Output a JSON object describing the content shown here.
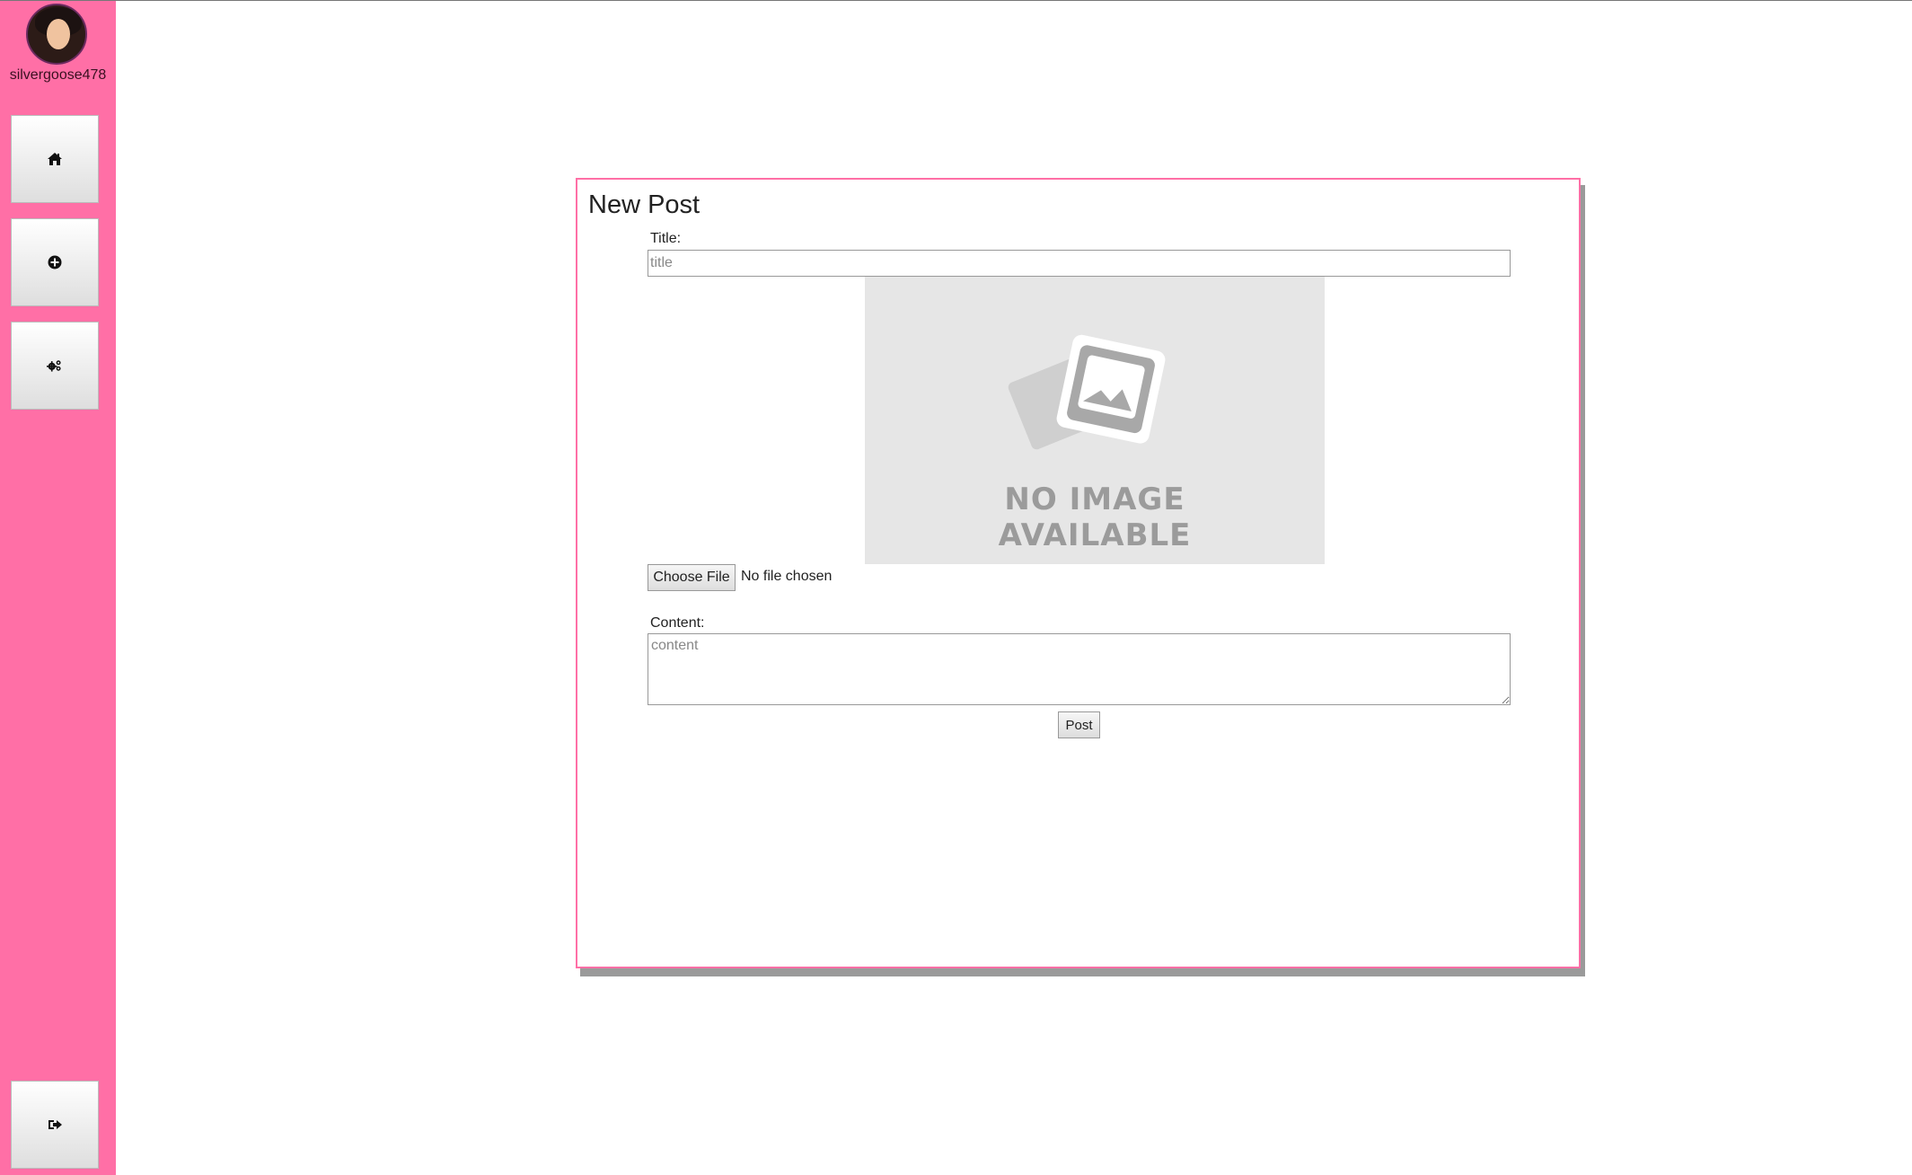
{
  "sidebar": {
    "username": "silvergoose478",
    "accent_color": "#ff6fa6",
    "nav": [
      {
        "icon": "home-icon"
      },
      {
        "icon": "plus-circle-icon"
      },
      {
        "icon": "gears-icon"
      }
    ],
    "logout_icon": "sign-out-icon"
  },
  "post_form": {
    "heading": "New Post",
    "title_label": "Title:",
    "title_placeholder": "title",
    "title_value": "",
    "image_placeholder_text_line1": "NO IMAGE",
    "image_placeholder_text_line2": "AVAILABLE",
    "choose_file_label": "Choose File",
    "file_status": "No file chosen",
    "content_label": "Content:",
    "content_placeholder": "content",
    "content_value": "",
    "submit_label": "Post"
  }
}
